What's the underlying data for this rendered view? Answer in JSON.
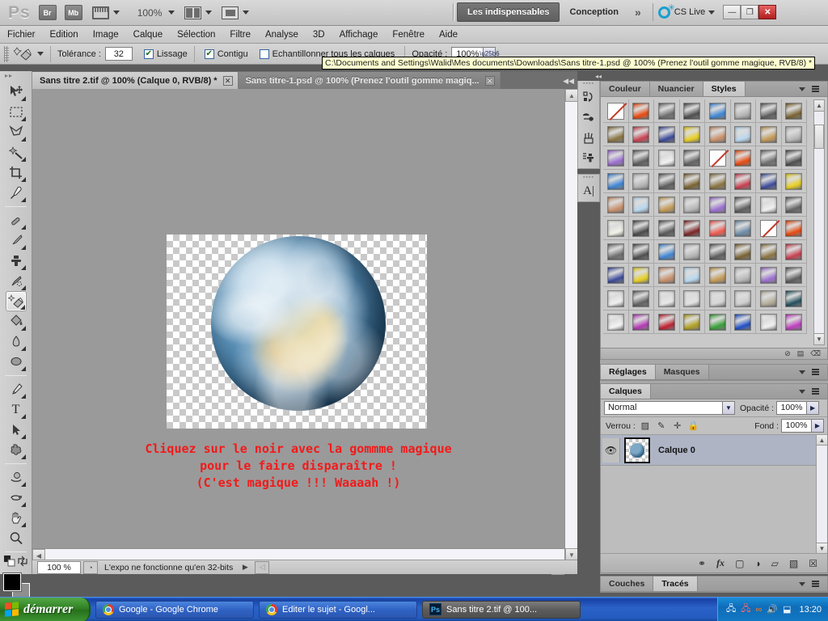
{
  "appbar": {
    "logo": "Ps",
    "bridge_button": "Br",
    "minibridge_button": "Mb",
    "zoom_value": "100%",
    "workspace_essentials": "Les indispensables",
    "workspace_design": "Conception",
    "workspace_more": "»",
    "cslive_label": "CS Live",
    "minimize": "—",
    "restore": "❐",
    "close": "✕"
  },
  "menu": [
    "Fichier",
    "Edition",
    "Image",
    "Calque",
    "Sélection",
    "Filtre",
    "Analyse",
    "3D",
    "Affichage",
    "Fenêtre",
    "Aide"
  ],
  "options": {
    "tolerance_label": "Tolérance :",
    "tolerance_value": "32",
    "lissage_label": "Lissage",
    "lissage_checked": "✔",
    "contigu_label": "Contigu",
    "contigu_checked": "✔",
    "echantillonner_label": "Echantillonner tous les calques",
    "opacite_label": "Opacité :",
    "opacite_value": "100%"
  },
  "tooltip": "C:\\Documents and Settings\\Walid\\Mes documents\\Downloads\\Sans titre-1.psd @ 100% (Prenez l'outil gomme magique, RVB/8) *",
  "tabs": [
    {
      "label": "Sans titre 2.tif @ 100% (Calque 0, RVB/8) *",
      "close": "✕",
      "active": true
    },
    {
      "label": "Sans titre-1.psd @ 100% (Prenez l'outil gomme magiq...",
      "close": "✕",
      "active": false
    }
  ],
  "tools": [
    {
      "name": "move-tool",
      "glyph": "➤"
    },
    {
      "name": "rectangular-marquee-tool",
      "glyph": "⬚"
    },
    {
      "name": "lasso-tool",
      "glyph": "✠"
    },
    {
      "name": "magic-wand-tool",
      "glyph": "✦"
    },
    {
      "name": "crop-tool",
      "glyph": "⌗"
    },
    {
      "name": "eyedropper-tool",
      "glyph": "✒"
    },
    {
      "name": "healing-brush-tool",
      "glyph": "✐"
    },
    {
      "name": "brush-tool",
      "glyph": "✎"
    },
    {
      "name": "clone-stamp-tool",
      "glyph": "✇"
    },
    {
      "name": "history-brush-tool",
      "glyph": "☙"
    },
    {
      "name": "magic-eraser-tool",
      "glyph": "❖"
    },
    {
      "name": "paint-bucket-tool",
      "glyph": "◢"
    },
    {
      "name": "blur-tool",
      "glyph": "◖"
    },
    {
      "name": "dodge-tool",
      "glyph": "●"
    },
    {
      "name": "pen-tool",
      "glyph": "✑"
    },
    {
      "name": "type-tool",
      "glyph": "T"
    },
    {
      "name": "path-selection-tool",
      "glyph": "➤"
    },
    {
      "name": "custom-shape-tool",
      "glyph": "★"
    },
    {
      "name": "rotate-3d-tool",
      "glyph": "◔"
    },
    {
      "name": "orbit-3d-tool",
      "glyph": "⟳"
    },
    {
      "name": "hand-tool",
      "glyph": "✋"
    },
    {
      "name": "zoom-tool",
      "glyph": "⌕"
    }
  ],
  "icon_dock": [
    {
      "name": "history-panel-icon",
      "glyph": "↺"
    },
    {
      "name": "actions-panel-icon",
      "glyph": "▶"
    },
    {
      "name": "brushes-panel-icon",
      "glyph": "❁"
    },
    {
      "name": "clone-source-panel-icon",
      "glyph": "✇"
    },
    {
      "name": "character-panel-icon",
      "glyph": "A"
    }
  ],
  "canvas": {
    "artwork_name": "earth-image",
    "text_lines": "Cliquez sur le noir avec la gommme magique\npour le faire disparaître !\n(C'est magique !!! Waaaah !)",
    "text_color": "#f21a1a"
  },
  "statusbar": {
    "zoom": "100 %",
    "message": "L'expo ne fonctionne qu'en 32-bits",
    "arrow": "▶"
  },
  "panels": {
    "top_group_tabs": [
      {
        "label": "Couleur",
        "active": false
      },
      {
        "label": "Nuancier",
        "active": false
      },
      {
        "label": "Styles",
        "active": true
      }
    ],
    "adjust_group_tabs": [
      {
        "label": "Réglages",
        "active": true
      },
      {
        "label": "Masques",
        "active": false
      }
    ],
    "layers_group_tabs": [
      {
        "label": "Calques",
        "active": true
      }
    ],
    "bottom_group_tabs": [
      {
        "label": "Couches",
        "active": false
      },
      {
        "label": "Tracés",
        "active": true
      }
    ],
    "blend_mode": "Normal",
    "opacity_label": "Opacité :",
    "opacity_value": "100%",
    "lock_label": "Verrou :",
    "fill_label": "Fond :",
    "fill_value": "100%",
    "layer_name": "Calque 0",
    "layer_buttons": [
      {
        "name": "link-layers-button",
        "glyph": "⚭"
      },
      {
        "name": "layer-style-button",
        "glyph": "fx"
      },
      {
        "name": "layer-mask-button",
        "glyph": "▢"
      },
      {
        "name": "adjustment-layer-button",
        "glyph": "◑"
      },
      {
        "name": "new-group-button",
        "glyph": "▱"
      },
      {
        "name": "new-layer-button",
        "glyph": "▧"
      },
      {
        "name": "delete-layer-button",
        "glyph": "☒"
      }
    ],
    "styles_swatches": [
      "none",
      "#e84a10",
      "#6e6e6e",
      "#4f4f4f",
      "#3f86d4",
      "#b4b4b4",
      "#5e5e5e",
      "#7a6333",
      "#8a7442",
      "#c84050",
      "#3c4a9a",
      "#e8d021",
      "#c9906a",
      "#b9d8ef",
      "#c49a55",
      "#b8b8b8",
      "#9b6fd0",
      "#5e5e5e",
      "#f0f0f0",
      "#636363",
      "none",
      "#e84a10",
      "#6e6e6e",
      "#4f4f4f",
      "#3f86d4",
      "#b4b4b4",
      "#5e5e5e",
      "#7a6333",
      "#8a7442",
      "#c84050",
      "#3c4a9a",
      "#e8d021",
      "#c9906a",
      "#b9d8ef",
      "#c49a55",
      "#b8b8b8",
      "#9b6fd0",
      "#5e5e5e",
      "#f0f0f0",
      "#636363",
      "#f2f2e8",
      "#4a4a4a",
      "#5a5a5a",
      "#7d2626",
      "#f05a50",
      "#6d8ca8",
      "none",
      "#e84a10",
      "#6e6e6e",
      "#4f4f4f",
      "#3f86d4",
      "#b4b4b4",
      "#5e5e5e",
      "#7a6333",
      "#8a7442",
      "#c84050",
      "#3c4a9a",
      "#e8d021",
      "#c9906a",
      "#b9d8ef",
      "#c49a55",
      "#b8b8b8",
      "#9b6fd0",
      "#5e5e5e",
      "#f0f0f0",
      "#636363",
      "#e8e8e8",
      "#e2e2e2",
      "#d6d6d6",
      "#cfcfcf",
      "#b5ae9a",
      "#24505e",
      "#f4f4f4",
      "#b43ab4",
      "#c02030",
      "#b0a020",
      "#38a038",
      "#2050c8",
      "#f0f0f0",
      "#c040c0"
    ]
  },
  "taskbar": {
    "start_label": "démarrer",
    "tasks": [
      {
        "label": "Google - Google Chrome",
        "icon": "chrome-icon",
        "active": false
      },
      {
        "label": "Editer le sujet - Googl...",
        "icon": "chrome-icon",
        "active": false
      },
      {
        "label": "Sans titre 2.tif @ 100...",
        "icon": "photoshop-icon",
        "active": true
      }
    ],
    "tray_icons": [
      "network-icon",
      "network-error-icon",
      "infinity-icon",
      "volume-icon",
      "update-icon"
    ],
    "clock": "13:20"
  }
}
